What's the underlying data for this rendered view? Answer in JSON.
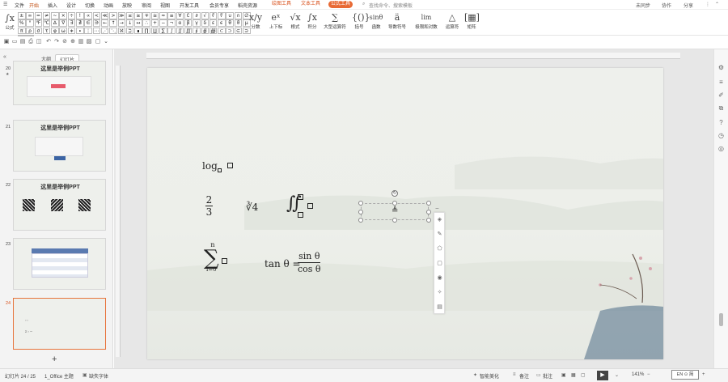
{
  "menu": {
    "file": "文件",
    "items": [
      "开始",
      "插入",
      "设计",
      "切换",
      "动画",
      "放映",
      "审阅",
      "视图",
      "开发工具",
      "会员专享",
      "稻壳资源"
    ],
    "tool_tabs": [
      "绘图工具",
      "文本工具",
      "公式工具"
    ],
    "search": "查找命令、搜索模板",
    "unsynced": "未同步",
    "collab": "协作",
    "share": "分享"
  },
  "ribbon": {
    "formula_label": "公式",
    "symbols": [
      "±",
      "∞",
      "=",
      "≠",
      "~",
      "×",
      "÷",
      "!",
      "∝",
      "<",
      "≪",
      ">",
      "≫",
      "≤",
      "≥",
      "∓",
      "≅",
      "≈",
      "≡",
      "∀",
      "∁",
      "∂",
      "√",
      "∛",
      "∜",
      "∪",
      "∩",
      "∅",
      "%",
      "°",
      "℉",
      "℃",
      "∆",
      "∇",
      "∃",
      "∄",
      "∈",
      "∋",
      "←",
      "↑",
      "→",
      "↓",
      "↔",
      "∴",
      "+",
      "−",
      "¬",
      "α",
      "β",
      "γ",
      "δ",
      "ε",
      "ϵ",
      "θ",
      "ϑ",
      "μ",
      "π",
      "ρ",
      "σ",
      "τ",
      "φ",
      "ω",
      "∗",
      "∙",
      "⋮",
      "⋯",
      "⋰",
      "⋱",
      "ℵ",
      "ℶ",
      "∎",
      "∏",
      "∐",
      "∑",
      "∫",
      "∬",
      "∭",
      "∮",
      "∯",
      "∰",
      "⊂",
      "⊃",
      "⊆",
      "⊇",
      "⊄",
      "⊅"
    ],
    "buttons": [
      {
        "icon": "x/y",
        "label": "分数"
      },
      {
        "icon": "eˣ",
        "label": "上下标"
      },
      {
        "icon": "√x",
        "label": "根式"
      },
      {
        "icon": "∫x",
        "label": "积分"
      },
      {
        "icon": "∑",
        "label": "大型运算符"
      },
      {
        "icon": "{()}",
        "label": "括号"
      },
      {
        "icon": "sinθ",
        "label": "函数"
      },
      {
        "icon": "ä",
        "label": "导数符号"
      },
      {
        "icon": "lim",
        "label": "极限和对数"
      },
      {
        "icon": "△",
        "label": "运算符"
      },
      {
        "icon": "[▦]",
        "label": "矩阵"
      }
    ]
  },
  "left_panel": {
    "tab_outline": "大纲",
    "tab_slides": "幻灯片",
    "thumbnails": [
      {
        "num": "20",
        "title": "这里是举例PPT"
      },
      {
        "num": "21",
        "title": "这里是举例PPT"
      },
      {
        "num": "22",
        "title": "这里是举例PPT"
      },
      {
        "num": "23",
        "title": ""
      },
      {
        "num": "24",
        "title": ""
      }
    ],
    "add": "+"
  },
  "slide": {
    "log": "log",
    "frac_num": "2",
    "frac_den": "3",
    "root": "∛4",
    "sum_top": "n",
    "sum_bottom": "i=0",
    "tan": "tan θ =",
    "sin": "sin θ",
    "cos": "cos θ",
    "selected": "≜"
  },
  "status": {
    "slide": "幻灯片 24 / 25",
    "theme": "1_Office 主题",
    "font_missing": "缺失字体",
    "beautify": "智能美化",
    "notes": "备注",
    "comments": "批注",
    "zoom": "141%",
    "ime": "EN ⊙ 简"
  }
}
